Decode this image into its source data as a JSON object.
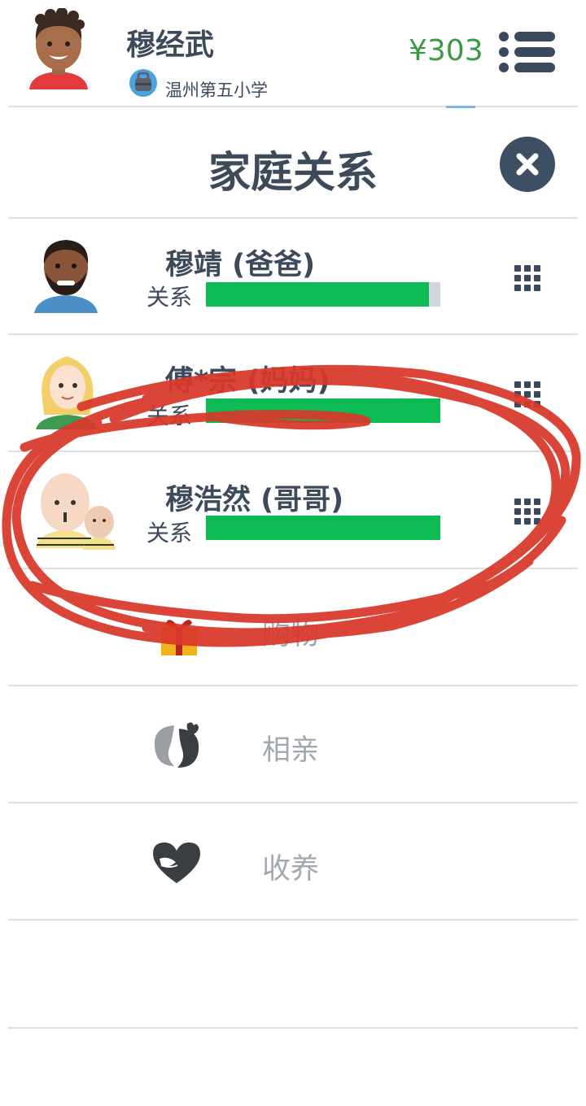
{
  "header": {
    "user_name": "穆经武",
    "school": "温州第五小学",
    "money": "¥303",
    "money_color": "#3b9a43"
  },
  "panel": {
    "title": "家庭关系"
  },
  "relatives": [
    {
      "name": "穆靖 (爸爸)",
      "relation_label": "关系",
      "relation_level": 0.95
    },
    {
      "name": "傅*宗 (妈妈)",
      "relation_label": "关系",
      "relation_level": 1.0
    },
    {
      "name": "穆浩然 (哥哥)",
      "relation_label": "关系",
      "relation_level": 1.0
    }
  ],
  "options": [
    {
      "label": "购物",
      "icon": "gift-icon"
    },
    {
      "label": "相亲",
      "icon": "kiss-icon"
    },
    {
      "label": "收养",
      "icon": "heart-hands-icon"
    }
  ],
  "colors": {
    "bar_fill": "#0dbb55",
    "bar_track": "#d0d6df",
    "close_button": "#3f4f63",
    "annotation": "#d9382a"
  }
}
